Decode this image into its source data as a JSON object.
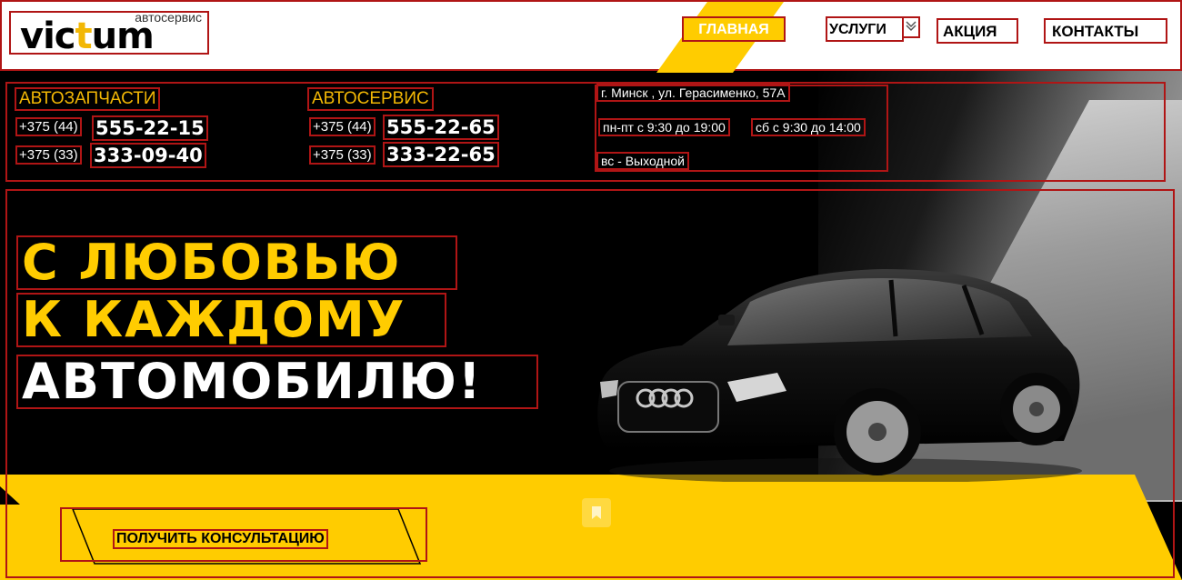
{
  "header": {
    "logo": {
      "brand_prefix": "vic",
      "brand_accent": "t",
      "brand_suffix": "um",
      "subtitle": "автосервис"
    },
    "nav": [
      {
        "label": "ГЛАВНАЯ",
        "active": true
      },
      {
        "label": "УСЛУГИ",
        "has_dropdown": true
      },
      {
        "label": "АКЦИЯ"
      },
      {
        "label": "КОНТАКТЫ"
      }
    ]
  },
  "info": {
    "parts": {
      "title": "АВТОЗАПЧАСТИ",
      "phones": [
        {
          "prefix": "+375 (44)",
          "number": "555-22-15"
        },
        {
          "prefix": "+375 (33)",
          "number": "333-09-40"
        }
      ]
    },
    "service": {
      "title": "АВТОСЕРВИС",
      "phones": [
        {
          "prefix": "+375 (44)",
          "number": "555-22-65"
        },
        {
          "prefix": "+375 (33)",
          "number": "333-22-65"
        }
      ]
    },
    "address": "г. Минск , ул. Герасименко, 57А",
    "hours_weekdays": "пн-пт с 9:30 до 19:00",
    "hours_saturday": "сб с 9:30 до 14:00",
    "hours_sunday": "вс - Выходной"
  },
  "hero": {
    "line1": "С ЛЮБОВЬЮ",
    "line2": "К КАЖДОМУ",
    "line3": "АВТОМОБИЛЮ!",
    "cta": "ПОЛУЧИТЬ КОНСУЛЬТАЦИЮ"
  },
  "colors": {
    "accent": "#ffcc00",
    "background": "#000000",
    "text_light": "#ffffff"
  },
  "icons": {
    "dropdown": "chevron-down-icon",
    "bookmark": "bookmark-icon"
  }
}
